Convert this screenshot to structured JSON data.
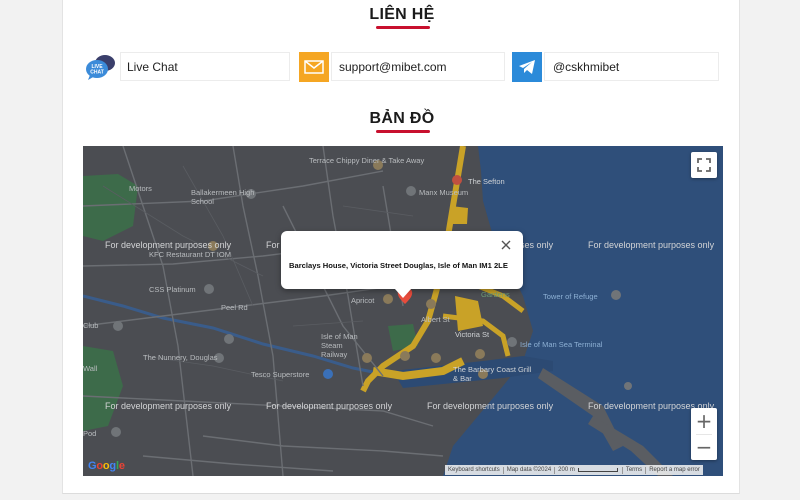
{
  "contact": {
    "title": "LIÊN HỆ",
    "items": [
      {
        "label": "Live Chat",
        "icon": "live-chat-icon",
        "icon_badge": "LIVE CHAT"
      },
      {
        "label": "support@mibet.com",
        "icon": "mail-icon",
        "color": "#f5a623"
      },
      {
        "label": "@cskhmibet",
        "icon": "telegram-icon",
        "color": "#2b8ad9"
      }
    ]
  },
  "map_section": {
    "title": "BẢN ĐỒ"
  },
  "map": {
    "popup": {
      "address": "Barclays House, Victoria Street Douglas, Isle of Man IM1 2LE"
    },
    "watermark": "For development purposes only",
    "places": [
      "Terrace Chippy Diner & Take Away",
      "Manx Museum",
      "The Sefton",
      "Ballakermeen High School",
      "Motors",
      "KFC Restaurant DT IOM",
      "CSS Platinum",
      "Peel Rd",
      "Club",
      "Apricot",
      "Gardens",
      "Tower of Refuge",
      "Isle of Man Steam Railway",
      "Victoria St",
      "Isle of Man Sea Terminal",
      "The Nunnery, Douglas",
      "Tesco Superstore",
      "The Barbary Coast Grill & Bar",
      "Wall",
      "Pod",
      "Albert St"
    ],
    "controls": {
      "fullscreen": "fullscreen-icon",
      "zoom_in": "+",
      "zoom_out": "−"
    },
    "footer": {
      "logo": "Google",
      "shortcuts": "Keyboard shortcuts",
      "map_data": "Map data ©2024",
      "scale": "200 m",
      "terms": "Terms",
      "report": "Report a map error"
    },
    "colors": {
      "land": "#4b4d52",
      "water": "#2f4f7a",
      "park": "#3d6b4a",
      "road_major": "#c9a227",
      "marker": "#e74c3c"
    }
  }
}
